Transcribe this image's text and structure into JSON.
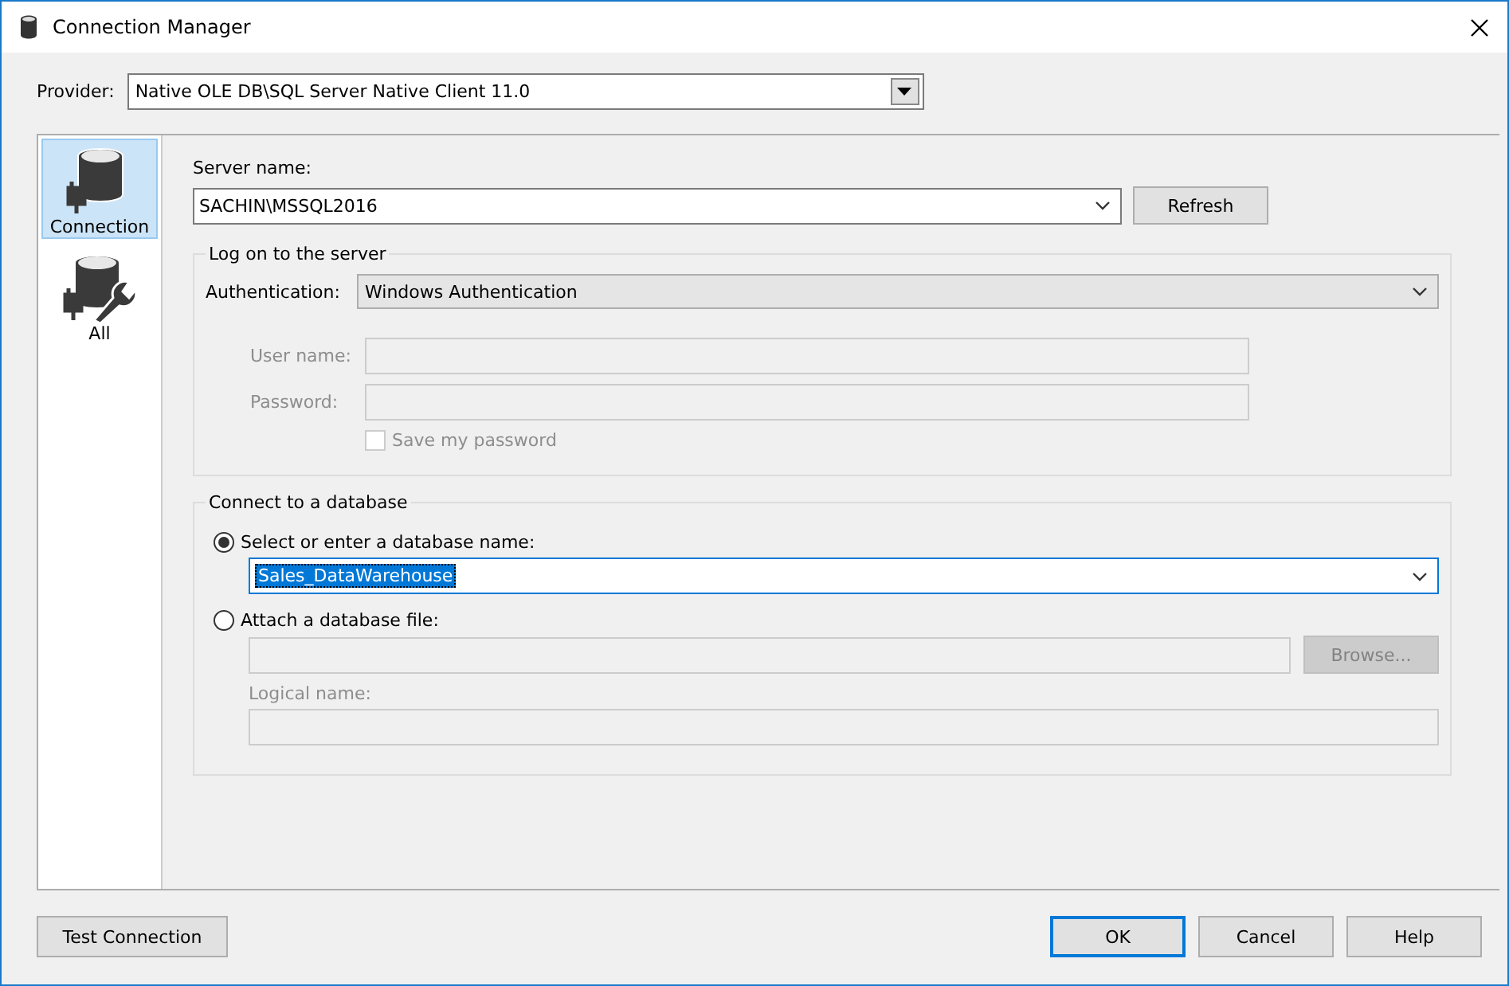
{
  "window": {
    "title": "Connection Manager"
  },
  "provider": {
    "label": "Provider:",
    "value": "Native OLE DB\\SQL Server Native Client 11.0"
  },
  "sidebar": {
    "items": [
      {
        "label": "Connection",
        "kind": "connection",
        "selected": true
      },
      {
        "label": "All",
        "kind": "all",
        "selected": false
      }
    ]
  },
  "server": {
    "label": "Server name:",
    "value": "SACHIN\\MSSQL2016",
    "refresh": "Refresh"
  },
  "logon": {
    "title": "Log on to the server",
    "authentication": {
      "label": "Authentication:",
      "value": "Windows Authentication"
    },
    "user_name": {
      "label": "User name:",
      "disabled": true
    },
    "password": {
      "label": "Password:",
      "disabled": true
    },
    "save_password": {
      "label": "Save my password",
      "checked": false,
      "disabled": true
    }
  },
  "database": {
    "title": "Connect to a database",
    "options": [
      {
        "label": "Select or enter a database name:",
        "selected": true
      },
      {
        "label": "Attach a database file:",
        "selected": false
      }
    ],
    "database_name": {
      "value": "Sales_DataWarehouse",
      "highlighted": true
    },
    "file": {
      "disabled": true
    },
    "browse": {
      "label": "Browse...",
      "disabled": true
    },
    "logical_name": {
      "label": "Logical name:",
      "disabled": true
    }
  },
  "buttons": {
    "test_connection": "Test Connection",
    "ok": "OK",
    "cancel": "Cancel",
    "help": "Help"
  }
}
